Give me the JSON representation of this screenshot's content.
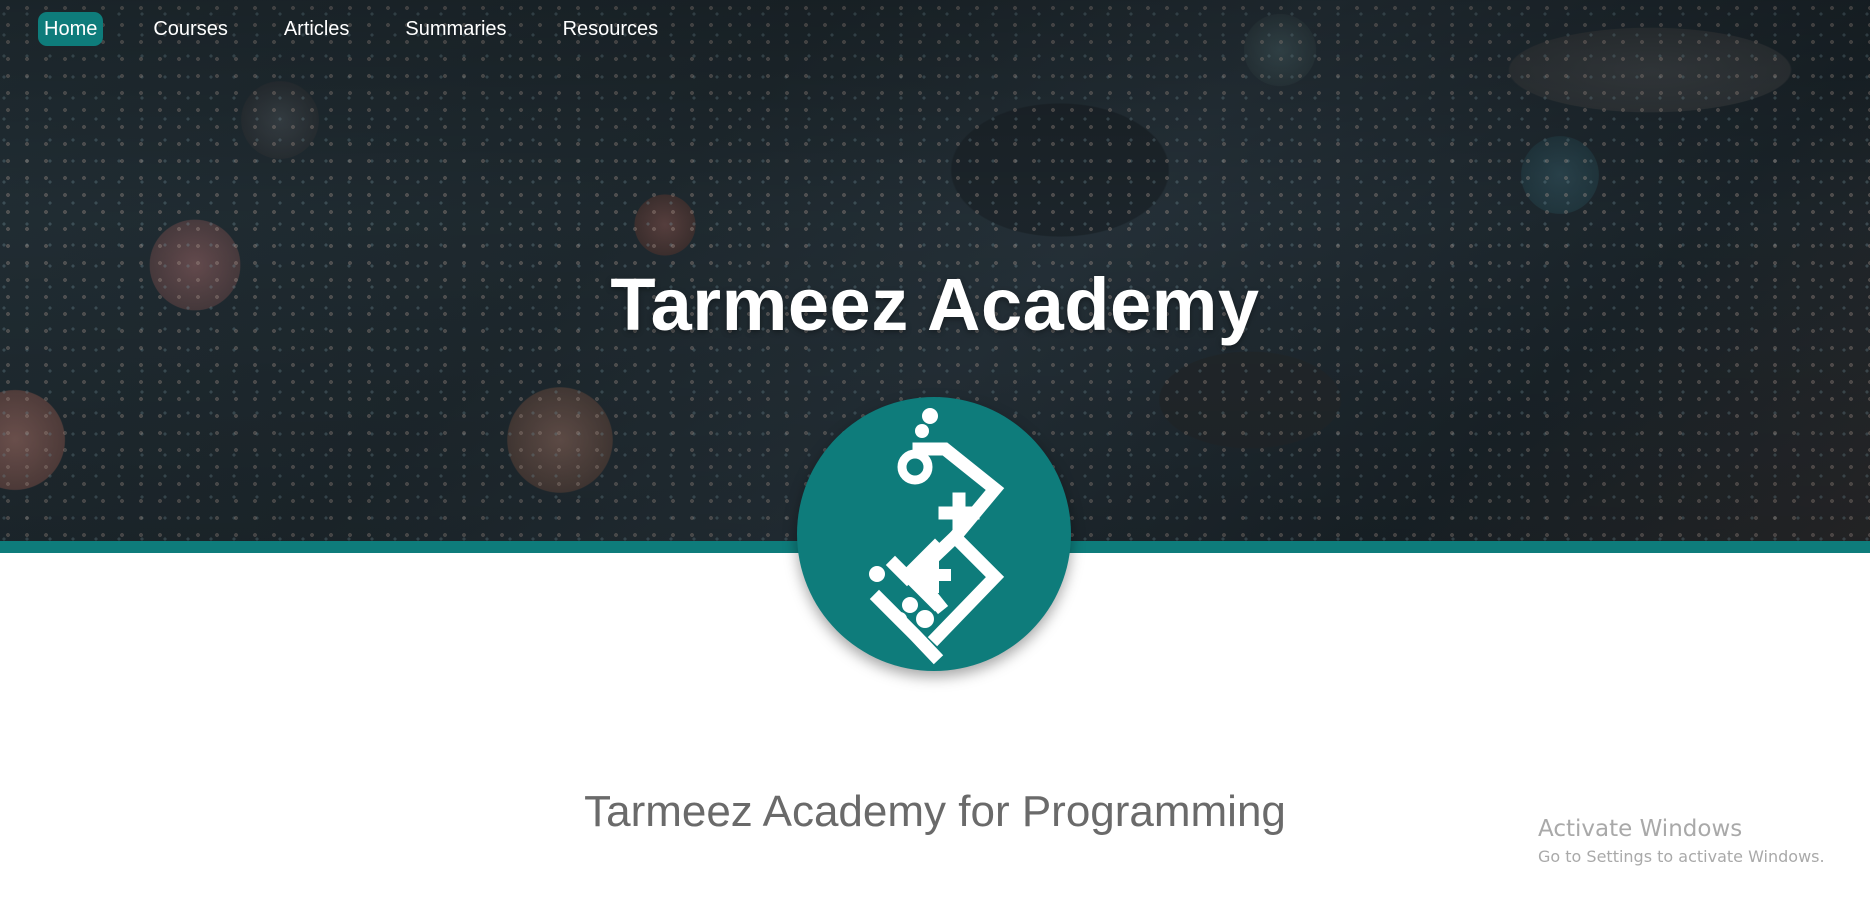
{
  "nav": {
    "items": [
      {
        "label": "Home",
        "active": true
      },
      {
        "label": "Courses",
        "active": false
      },
      {
        "label": "Articles",
        "active": false
      },
      {
        "label": "Summaries",
        "active": false
      },
      {
        "label": "Resources",
        "active": false
      }
    ]
  },
  "hero": {
    "title": "Tarmeez Academy"
  },
  "logo": {
    "icon": "tarmeez-logo-icon"
  },
  "main": {
    "subtitle": "Tarmeez Academy for Programming"
  },
  "windows_watermark": {
    "title": "Activate Windows",
    "subtitle": "Go to Settings to activate Windows."
  },
  "colors": {
    "accent": "#0e7c7b",
    "hero_text": "#ffffff",
    "subtitle_text": "#6a6a6a",
    "watermark_text": "#a9a9a9"
  }
}
